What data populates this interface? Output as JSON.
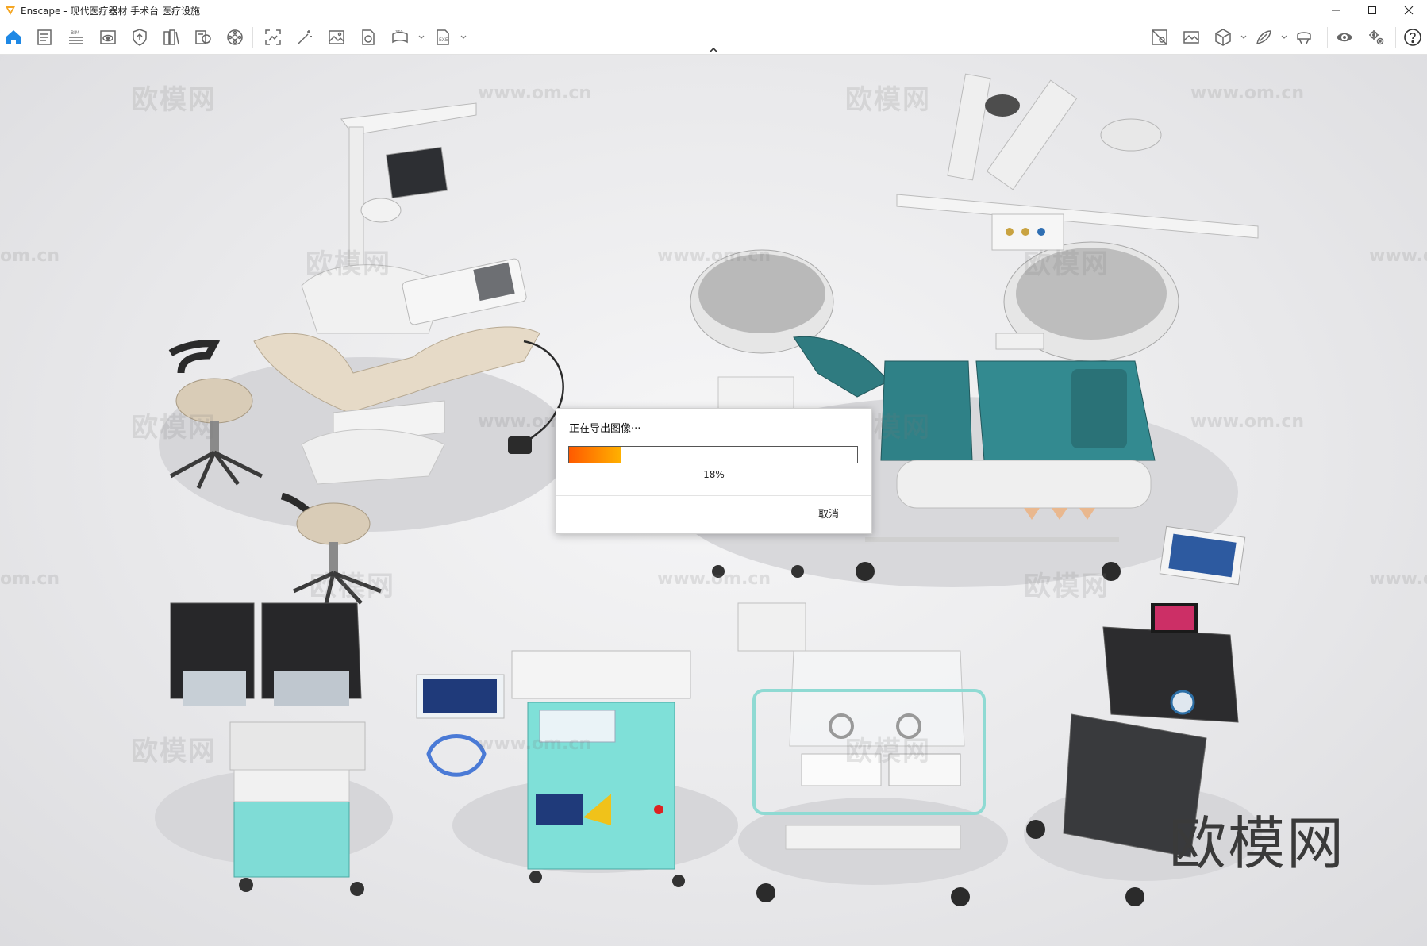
{
  "window": {
    "title": "Enscape - 现代医疗器材 手术台 医疗设施",
    "controls": [
      "minimize-icon",
      "maximize-icon",
      "close-icon"
    ]
  },
  "toolbar": {
    "left_icons": [
      "home-icon",
      "notes-icon",
      "bim-icon",
      "views-icon",
      "upload-icon",
      "library-icon",
      "material-icon",
      "settings-wheel-icon",
      "screenshot-icon",
      "magic-wand-icon",
      "image-icon",
      "video-icon",
      "panorama-360-icon",
      "export-icon"
    ],
    "bim_label": "BIM",
    "right_icons": [
      "map-icon",
      "gallery-icon",
      "cube-icon",
      "sketch-icon",
      "vr-headset-icon",
      "eye-icon",
      "gears-icon",
      "help-icon"
    ],
    "accent": "#1e88e5"
  },
  "viewport": {
    "watermark_text": "欧模网",
    "watermark_url": "www.om.cn",
    "watermark_url_partial": "om.cn",
    "watermark_url_prefix": "www.o",
    "big_watermark": "欧模网"
  },
  "dialog": {
    "title": "正在导出图像···",
    "progress_value": 0.18,
    "progress_text": "18%",
    "cancel_label": "取消",
    "progress_colors": [
      "#ff5a00",
      "#ffb000"
    ]
  }
}
